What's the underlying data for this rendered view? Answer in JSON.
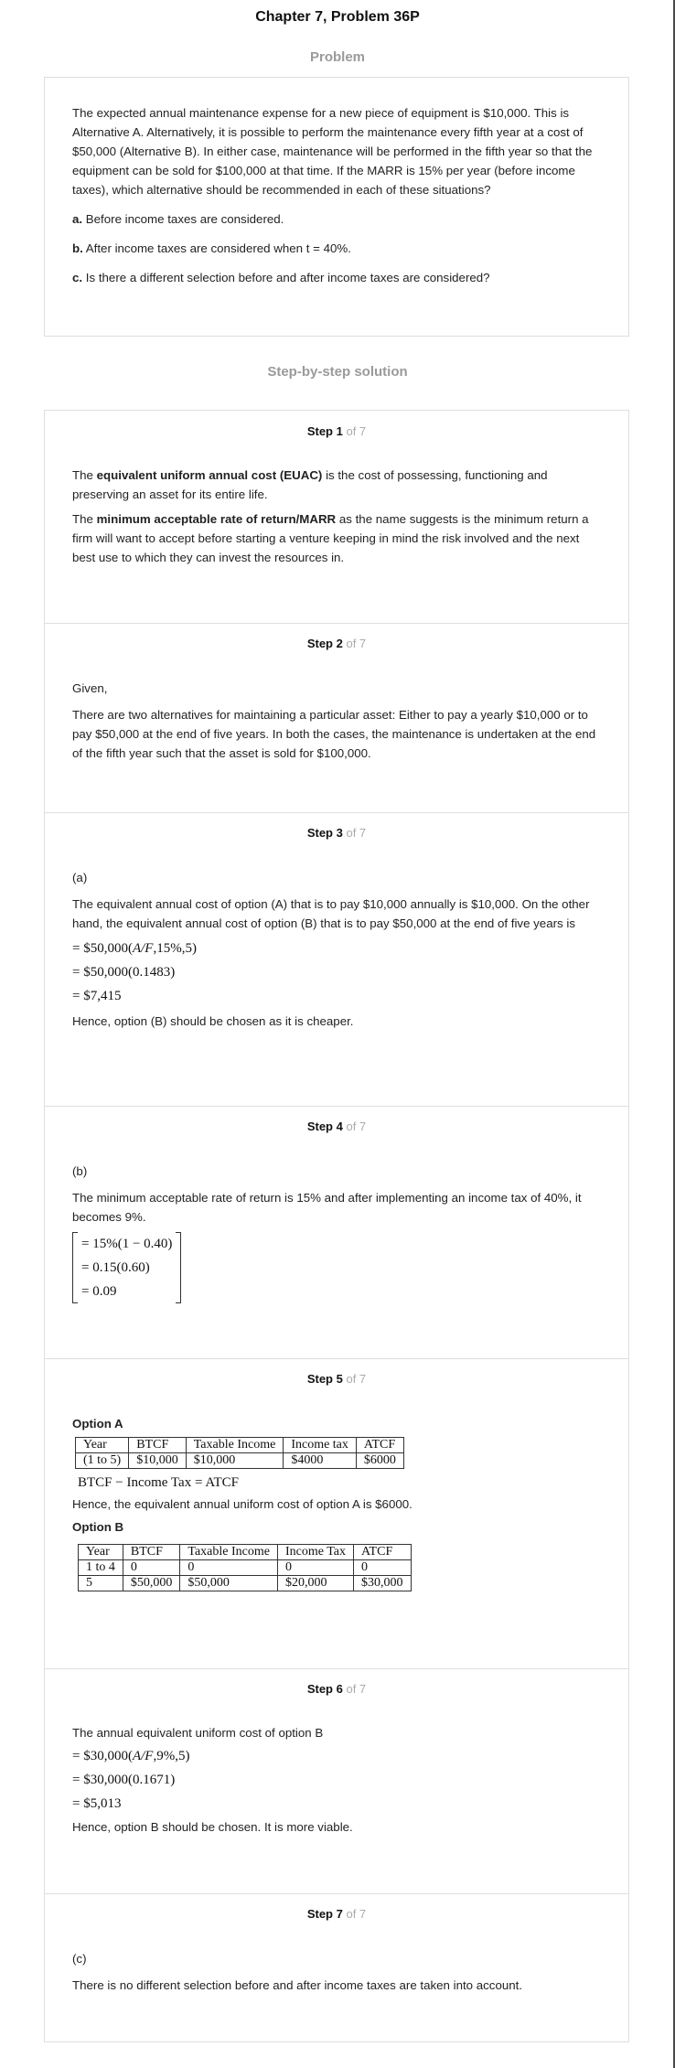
{
  "page_title": "Chapter 7, Problem 36P",
  "problem_heading": "Problem",
  "problem": {
    "text": "The expected annual maintenance expense for a new piece of equipment is $10,000. This is Alternative A. Alternatively, it is possible to perform the maintenance every fifth year at a cost of $50,000 (Alternative B). In either case, maintenance will be performed in the fifth year so that the equipment can be sold for $100,000 at that time. If the MARR is 15% per year (before income taxes), which alternative should be recommended in each of these situations?",
    "a_label": "a.",
    "a_text": "Before income taxes are considered.",
    "b_label": "b.",
    "b_text": "After income taxes are considered when t = 40%.",
    "c_label": "c.",
    "c_text": "Is there a different selection before and after income taxes are considered?"
  },
  "solution_heading": "Step-by-step solution",
  "steps": [
    {
      "label": "Step 1",
      "of": "of 7"
    },
    {
      "label": "Step 2",
      "of": "of 7"
    },
    {
      "label": "Step 3",
      "of": "of 7"
    },
    {
      "label": "Step 4",
      "of": "of 7"
    },
    {
      "label": "Step 5",
      "of": "of 7"
    },
    {
      "label": "Step 6",
      "of": "of 7"
    },
    {
      "label": "Step 7",
      "of": "of 7"
    }
  ],
  "step1": {
    "p1_pre": "The ",
    "p1_bold": "equivalent uniform annual cost (EUAC)",
    "p1_post": " is the cost of possessing, functioning and preserving an asset for its entire life.",
    "p2_pre": "The ",
    "p2_bold": "minimum acceptable rate of return/MARR",
    "p2_post": " as the name suggests is the minimum return a firm will want to accept before starting a venture keeping in mind the risk involved and the next best use to which they can invest the resources in."
  },
  "step2": {
    "given": "Given,",
    "text": "There are two alternatives for maintaining a particular asset: Either to pay a yearly $10,000 or to pay $50,000 at the end of five years. In both the cases, the maintenance is undertaken at the end of the fifth year such that the asset is sold for $100,000."
  },
  "step3": {
    "part": "(a)",
    "text": "The equivalent annual cost of option (A) that is to pay $10,000 annually is $10,000. On the other hand, the equivalent annual cost of option (B) that is to pay $50,000 at the end of five years is",
    "m1_pre": "= $50,000(",
    "m1_it": "A/F",
    "m1_post": ",15%,5)",
    "m2": "= $50,000(0.1483)",
    "m3": "= $7,415",
    "conclusion": "Hence, option (B) should be chosen as it is cheaper."
  },
  "step4": {
    "part": "(b)",
    "text": "The minimum acceptable rate of return is 15% and after implementing an income tax of 40%, it becomes 9%.",
    "m1": "= 15%(1 − 0.40)",
    "m2": "= 0.15(0.60)",
    "m3": "= 0.09"
  },
  "step5": {
    "option_a": "Option A",
    "table_a": {
      "headers": [
        "Year",
        "BTCF",
        "Taxable Income",
        "Income tax",
        "ATCF"
      ],
      "row": [
        "(1 to 5)",
        "$10,000",
        "$10,000",
        "$4000",
        "$6000"
      ]
    },
    "formula": "BTCF − Income Tax = ATCF",
    "conclusion_a": "Hence, the equivalent annual uniform cost of option A is $6000.",
    "option_b": "Option B",
    "table_b": {
      "headers": [
        "Year",
        "BTCF",
        "Taxable Income",
        "Income Tax",
        "ATCF"
      ],
      "row1": [
        "1 to 4",
        "0",
        "0",
        "0",
        "0"
      ],
      "row2": [
        "5",
        "$50,000",
        "$50,000",
        "$20,000",
        "$30,000"
      ]
    }
  },
  "step6": {
    "text": "The annual equivalent uniform cost of option B",
    "m1_pre": "= $30,000(",
    "m1_it": "A/F",
    "m1_post": ",9%,5)",
    "m2": "= $30,000(0.1671)",
    "m3": "= $5,013",
    "conclusion": "Hence, option B should be chosen. It is more viable."
  },
  "step7": {
    "part": "(c)",
    "text": "There is no different selection before and after income taxes are taken into account."
  }
}
